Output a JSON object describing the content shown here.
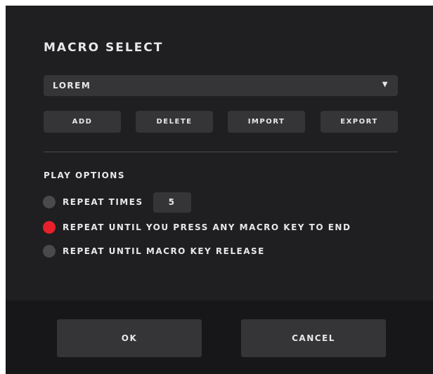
{
  "dialog": {
    "title": "MACRO SELECT"
  },
  "macro_select": {
    "value": "LOREM",
    "caret": "▼"
  },
  "actions": {
    "add": "ADD",
    "delete": "DELETE",
    "import": "IMPORT",
    "export": "EXPORT"
  },
  "play_options": {
    "label": "PLAY OPTIONS",
    "selected_index": 1,
    "options": [
      {
        "label": "REPEAT TIMES"
      },
      {
        "label": "REPEAT UNTIL YOU PRESS ANY MACRO KEY TO END"
      },
      {
        "label": "REPEAT UNTIL MACRO KEY RELEASE"
      }
    ],
    "repeat_count": "5"
  },
  "footer": {
    "ok": "OK",
    "cancel": "CANCEL"
  },
  "colors": {
    "dialog_bg": "#1f1f21",
    "footer_bg": "#171719",
    "control_bg": "#353538",
    "accent_selected": "#e8202a",
    "radio_unselected": "#4a4a4d"
  }
}
